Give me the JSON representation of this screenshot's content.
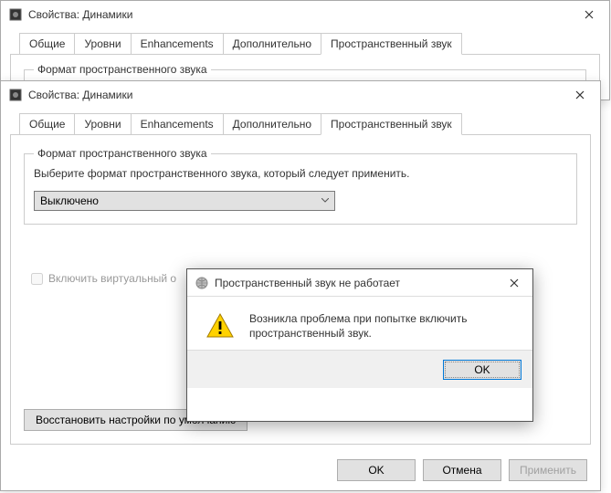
{
  "win1": {
    "title": "Свойства: Динамики",
    "tabs": [
      "Общие",
      "Уровни",
      "Enhancements",
      "Дополнительно",
      "Пространственный звук"
    ],
    "active_tab": 4,
    "group_title": "Формат пространственного звука"
  },
  "win2": {
    "title": "Свойства: Динамики",
    "tabs": [
      "Общие",
      "Уровни",
      "Enhancements",
      "Дополнительно",
      "Пространственный звук"
    ],
    "active_tab": 4,
    "group_title": "Формат пространственного звука",
    "instruction": "Выберите формат пространственного звука, который следует применить.",
    "dropdown_value": "Выключено",
    "checkbox_label": "Включить виртуальный о",
    "restore_label": "Восстановить настройки по умолчанию",
    "buttons": {
      "ok": "OK",
      "cancel": "Отмена",
      "apply": "Применить"
    }
  },
  "dialog": {
    "title": "Пространственный звук не работает",
    "message": "Возникла проблема при попытке включить пространственный звук.",
    "ok": "OK"
  }
}
